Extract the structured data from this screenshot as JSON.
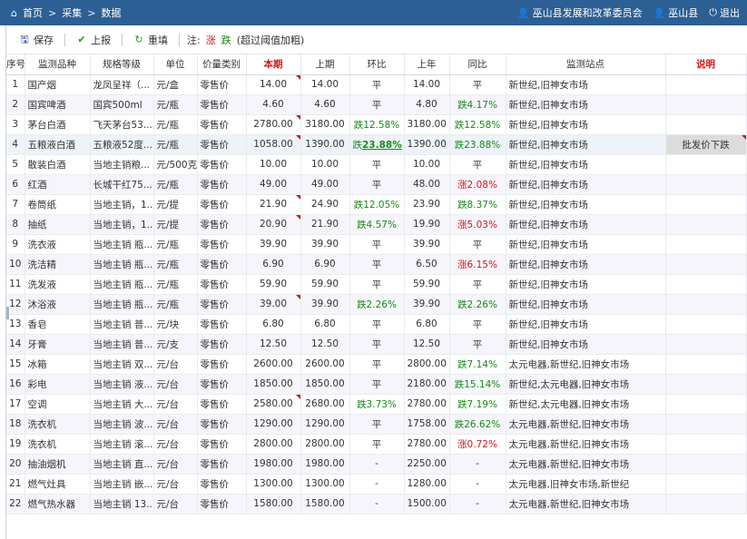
{
  "topbar": {
    "breadcrumb": [
      "首页",
      "采集",
      "数据"
    ],
    "org": "巫山县发展和改革委员会",
    "county": "巫山县",
    "logout": "退出"
  },
  "toolbar": {
    "save": "保存",
    "report": "上报",
    "refill": "重填",
    "note_prefix": "注:",
    "note_up": "涨",
    "note_down": "跌",
    "note_suffix": "(超过阈值加粗)"
  },
  "columns": [
    "序号",
    "监测品种",
    "规格等级",
    "单位",
    "价量类别",
    "本期",
    "上期",
    "环比",
    "上年",
    "同比",
    "监测站点",
    "说明"
  ],
  "rows": [
    {
      "no": "1",
      "name": "国产烟",
      "spec": "龙凤呈祥（...",
      "unit": "元/盒",
      "cat": "零售价",
      "cur": "14.00",
      "prev": "14.00",
      "mom": "平",
      "momd": "",
      "ly": "14.00",
      "yoy": "平",
      "yoyd": "",
      "site": "新世纪,旧神女市场",
      "note": "",
      "mark": true
    },
    {
      "no": "2",
      "name": "国宾啤酒",
      "spec": "国宾500ml",
      "unit": "元/瓶",
      "cat": "零售价",
      "cur": "4.60",
      "prev": "4.60",
      "mom": "平",
      "momd": "",
      "ly": "4.80",
      "yoy": "跌4.17%",
      "yoyd": "down",
      "site": "新世纪,旧神女市场",
      "note": "",
      "mark": false
    },
    {
      "no": "3",
      "name": "茅台白酒",
      "spec": "飞天茅台53...",
      "unit": "元/瓶",
      "cat": "零售价",
      "cur": "2780.00",
      "prev": "3180.00",
      "mom": "跌12.58%",
      "momd": "down",
      "ly": "3180.00",
      "yoy": "跌12.58%",
      "yoyd": "down",
      "site": "新世纪,旧神女市场",
      "note": "",
      "mark": true
    },
    {
      "no": "4",
      "name": "五粮液白酒",
      "spec": "五粮液52度...",
      "unit": "元/瓶",
      "cat": "零售价",
      "cur": "1058.00",
      "prev": "1390.00",
      "mom": "跌23.88%",
      "momd": "down bold",
      "ly": "1390.00",
      "yoy": "跌23.88%",
      "yoyd": "down",
      "site": "新世纪,旧神女市场",
      "note": "批发价下跌",
      "mark": true
    },
    {
      "no": "5",
      "name": "散装白酒",
      "spec": "当地主销粮...",
      "unit": "元/500克",
      "cat": "零售价",
      "cur": "10.00",
      "prev": "10.00",
      "mom": "平",
      "momd": "",
      "ly": "10.00",
      "yoy": "平",
      "yoyd": "",
      "site": "新世纪,旧神女市场",
      "note": "",
      "mark": false
    },
    {
      "no": "6",
      "name": "红酒",
      "spec": "长城干红75...",
      "unit": "元/瓶",
      "cat": "零售价",
      "cur": "49.00",
      "prev": "49.00",
      "mom": "平",
      "momd": "",
      "ly": "48.00",
      "yoy": "涨2.08%",
      "yoyd": "up",
      "site": "新世纪,旧神女市场",
      "note": "",
      "mark": false
    },
    {
      "no": "7",
      "name": "卷筒纸",
      "spec": "当地主销，1...",
      "unit": "元/提",
      "cat": "零售价",
      "cur": "21.90",
      "prev": "24.90",
      "mom": "跌12.05%",
      "momd": "down",
      "ly": "23.90",
      "yoy": "跌8.37%",
      "yoyd": "down",
      "site": "新世纪,旧神女市场",
      "note": "",
      "mark": true
    },
    {
      "no": "8",
      "name": "抽纸",
      "spec": "当地主销，1...",
      "unit": "元/提",
      "cat": "零售价",
      "cur": "20.90",
      "prev": "21.90",
      "mom": "跌4.57%",
      "momd": "down",
      "ly": "19.90",
      "yoy": "涨5.03%",
      "yoyd": "up",
      "site": "新世纪,旧神女市场",
      "note": "",
      "mark": true
    },
    {
      "no": "9",
      "name": "洗衣液",
      "spec": "当地主销 瓶...",
      "unit": "元/瓶",
      "cat": "零售价",
      "cur": "39.90",
      "prev": "39.90",
      "mom": "平",
      "momd": "",
      "ly": "39.90",
      "yoy": "平",
      "yoyd": "",
      "site": "新世纪,旧神女市场",
      "note": "",
      "mark": false
    },
    {
      "no": "10",
      "name": "洗洁精",
      "spec": "当地主销 瓶...",
      "unit": "元/瓶",
      "cat": "零售价",
      "cur": "6.90",
      "prev": "6.90",
      "mom": "平",
      "momd": "",
      "ly": "6.50",
      "yoy": "涨6.15%",
      "yoyd": "up",
      "site": "新世纪,旧神女市场",
      "note": "",
      "mark": false
    },
    {
      "no": "11",
      "name": "洗发液",
      "spec": "当地主销 瓶...",
      "unit": "元/瓶",
      "cat": "零售价",
      "cur": "59.90",
      "prev": "59.90",
      "mom": "平",
      "momd": "",
      "ly": "59.90",
      "yoy": "平",
      "yoyd": "",
      "site": "新世纪,旧神女市场",
      "note": "",
      "mark": false
    },
    {
      "no": "12",
      "name": "沐浴液",
      "spec": "当地主销 瓶...",
      "unit": "元/瓶",
      "cat": "零售价",
      "cur": "39.00",
      "prev": "39.90",
      "mom": "跌2.26%",
      "momd": "down",
      "ly": "39.90",
      "yoy": "跌2.26%",
      "yoyd": "down",
      "site": "新世纪,旧神女市场",
      "note": "",
      "mark": true
    },
    {
      "no": "13",
      "name": "香皂",
      "spec": "当地主销 普...",
      "unit": "元/块",
      "cat": "零售价",
      "cur": "6.80",
      "prev": "6.80",
      "mom": "平",
      "momd": "",
      "ly": "6.80",
      "yoy": "平",
      "yoyd": "",
      "site": "新世纪,旧神女市场",
      "note": "",
      "mark": false
    },
    {
      "no": "14",
      "name": "牙膏",
      "spec": "当地主销 普...",
      "unit": "元/支",
      "cat": "零售价",
      "cur": "12.50",
      "prev": "12.50",
      "mom": "平",
      "momd": "",
      "ly": "12.50",
      "yoy": "平",
      "yoyd": "",
      "site": "新世纪,旧神女市场",
      "note": "",
      "mark": false
    },
    {
      "no": "15",
      "name": "冰箱",
      "spec": "当地主销 双...",
      "unit": "元/台",
      "cat": "零售价",
      "cur": "2600.00",
      "prev": "2600.00",
      "mom": "平",
      "momd": "",
      "ly": "2800.00",
      "yoy": "跌7.14%",
      "yoyd": "down",
      "site": "太元电器,新世纪,旧神女市场",
      "note": "",
      "mark": false
    },
    {
      "no": "16",
      "name": "彩电",
      "spec": "当地主销 液...",
      "unit": "元/台",
      "cat": "零售价",
      "cur": "1850.00",
      "prev": "1850.00",
      "mom": "平",
      "momd": "",
      "ly": "2180.00",
      "yoy": "跌15.14%",
      "yoyd": "down",
      "site": "新世纪,太元电器,旧神女市场",
      "note": "",
      "mark": false
    },
    {
      "no": "17",
      "name": "空调",
      "spec": "当地主销 大...",
      "unit": "元/台",
      "cat": "零售价",
      "cur": "2580.00",
      "prev": "2680.00",
      "mom": "跌3.73%",
      "momd": "down",
      "ly": "2780.00",
      "yoy": "跌7.19%",
      "yoyd": "down",
      "site": "新世纪,太元电器,旧神女市场",
      "note": "",
      "mark": true
    },
    {
      "no": "18",
      "name": "洗衣机",
      "spec": "当地主销 波...",
      "unit": "元/台",
      "cat": "零售价",
      "cur": "1290.00",
      "prev": "1290.00",
      "mom": "平",
      "momd": "",
      "ly": "1758.00",
      "yoy": "跌26.62%",
      "yoyd": "down",
      "site": "太元电器,新世纪,旧神女市场",
      "note": "",
      "mark": false
    },
    {
      "no": "19",
      "name": "洗衣机",
      "spec": "当地主销 滚...",
      "unit": "元/台",
      "cat": "零售价",
      "cur": "2800.00",
      "prev": "2800.00",
      "mom": "平",
      "momd": "",
      "ly": "2780.00",
      "yoy": "涨0.72%",
      "yoyd": "up",
      "site": "太元电器,新世纪,旧神女市场",
      "note": "",
      "mark": false
    },
    {
      "no": "20",
      "name": "抽油烟机",
      "spec": "当地主销 直...",
      "unit": "元/台",
      "cat": "零售价",
      "cur": "1980.00",
      "prev": "1980.00",
      "mom": "-",
      "momd": "",
      "ly": "2250.00",
      "yoy": "-",
      "yoyd": "",
      "site": "太元电器,新世纪,旧神女市场",
      "note": "",
      "mark": false
    },
    {
      "no": "21",
      "name": "燃气灶具",
      "spec": "当地主销 嵌...",
      "unit": "元/台",
      "cat": "零售价",
      "cur": "1300.00",
      "prev": "1300.00",
      "mom": "-",
      "momd": "",
      "ly": "1280.00",
      "yoy": "-",
      "yoyd": "",
      "site": "太元电器,旧神女市场,新世纪",
      "note": "",
      "mark": false
    },
    {
      "no": "22",
      "name": "燃气热水器",
      "spec": "当地主销 13...",
      "unit": "元/台",
      "cat": "零售价",
      "cur": "1580.00",
      "prev": "1580.00",
      "mom": "-",
      "momd": "",
      "ly": "1500.00",
      "yoy": "-",
      "yoyd": "",
      "site": "太元电器,新世纪,旧神女市场",
      "note": "",
      "mark": false
    }
  ]
}
